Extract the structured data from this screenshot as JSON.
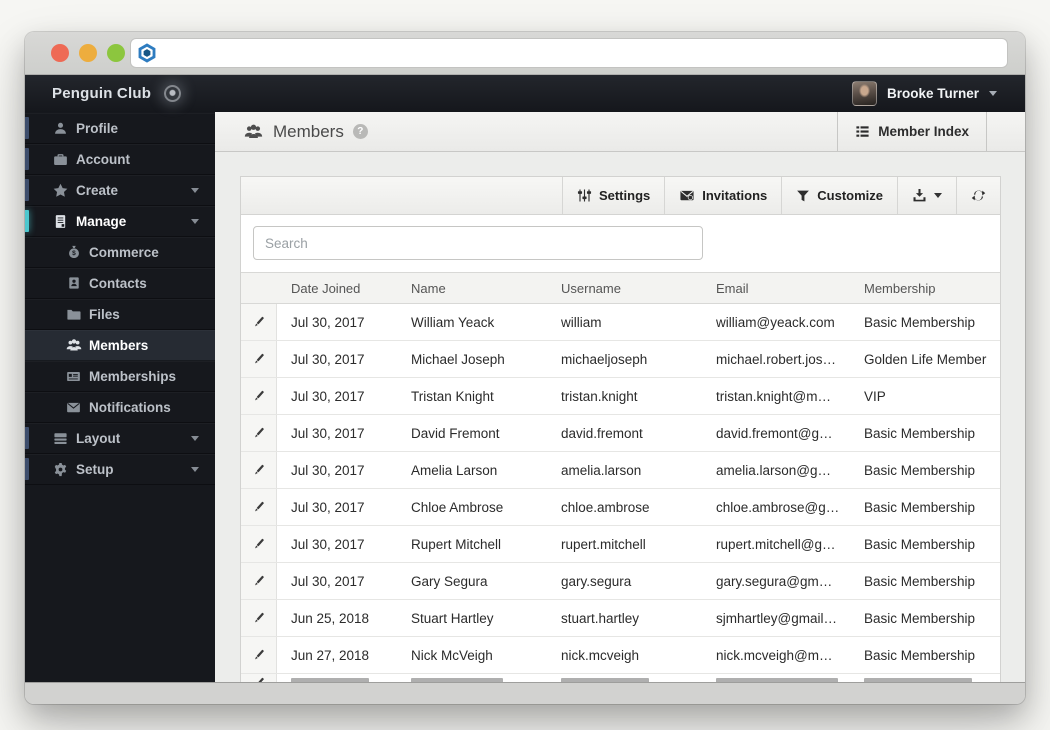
{
  "app": {
    "brand": "Penguin Club",
    "user_name": "Brooke Turner"
  },
  "sidebar": {
    "items": [
      {
        "label": "Profile",
        "icon": "person",
        "level": "top"
      },
      {
        "label": "Account",
        "icon": "briefcase",
        "level": "top"
      },
      {
        "label": "Create",
        "icon": "star",
        "level": "top",
        "caret": true
      },
      {
        "label": "Manage",
        "icon": "journal",
        "level": "top",
        "caret": true,
        "expanded": true,
        "edge_active": true
      },
      {
        "label": "Commerce",
        "icon": "money-bag",
        "level": "sub"
      },
      {
        "label": "Contacts",
        "icon": "contact-card",
        "level": "sub"
      },
      {
        "label": "Files",
        "icon": "folder",
        "level": "sub"
      },
      {
        "label": "Members",
        "icon": "people",
        "level": "sub",
        "active": true
      },
      {
        "label": "Memberships",
        "icon": "id-card",
        "level": "sub"
      },
      {
        "label": "Notifications",
        "icon": "envelope",
        "level": "sub"
      },
      {
        "label": "Layout",
        "icon": "rows",
        "level": "top",
        "caret": true
      },
      {
        "label": "Setup",
        "icon": "gear",
        "level": "top",
        "caret": true
      }
    ]
  },
  "page": {
    "title": "Members",
    "member_index": "Member Index"
  },
  "toolbar": {
    "settings": "Settings",
    "invitations": "Invitations",
    "customize": "Customize"
  },
  "search": {
    "placeholder": "Search"
  },
  "table": {
    "columns": [
      "Date Joined",
      "Name",
      "Username",
      "Email",
      "Membership"
    ],
    "rows": [
      {
        "date": "Jul 30, 2017",
        "name": "William Yeack",
        "username": "william",
        "email": "william@yeack.com",
        "membership": "Basic Membership"
      },
      {
        "date": "Jul 30, 2017",
        "name": "Michael Joseph",
        "username": "michaeljoseph",
        "email": "michael.robert.jos…",
        "membership": "Golden Life Member"
      },
      {
        "date": "Jul 30, 2017",
        "name": "Tristan Knight",
        "username": "tristan.knight",
        "email": "tristan.knight@m…",
        "membership": "VIP"
      },
      {
        "date": "Jul 30, 2017",
        "name": "David Fremont",
        "username": "david.fremont",
        "email": "david.fremont@g…",
        "membership": "Basic Membership"
      },
      {
        "date": "Jul 30, 2017",
        "name": "Amelia Larson",
        "username": "amelia.larson",
        "email": "amelia.larson@g…",
        "membership": "Basic Membership"
      },
      {
        "date": "Jul 30, 2017",
        "name": "Chloe Ambrose",
        "username": "chloe.ambrose",
        "email": "chloe.ambrose@g…",
        "membership": "Basic Membership"
      },
      {
        "date": "Jul 30, 2017",
        "name": "Rupert Mitchell",
        "username": "rupert.mitchell",
        "email": "rupert.mitchell@g…",
        "membership": "Basic Membership"
      },
      {
        "date": "Jul 30, 2017",
        "name": "Gary Segura",
        "username": "gary.segura",
        "email": "gary.segura@gm…",
        "membership": "Basic Membership"
      },
      {
        "date": "Jun 25, 2018",
        "name": "Stuart Hartley",
        "username": "stuart.hartley",
        "email": "sjmhartley@gmail…",
        "membership": "Basic Membership"
      },
      {
        "date": "Jun 27, 2018",
        "name": "Nick McVeigh",
        "username": "nick.mcveigh",
        "email": "nick.mcveigh@m…",
        "membership": "Basic Membership"
      }
    ],
    "partial_row_visible": true
  },
  "colors": {
    "sidebar_bg": "#16181d",
    "header_bg": "#17191d",
    "active_item_bg": "#262b33",
    "accent_teal": "#4cc7ce",
    "edge_tab_blue": "#3e4e6c",
    "traffic_red": "#ee6a55",
    "traffic_yellow": "#edad3e",
    "traffic_green": "#8cc63e",
    "logo_blue": "#2e7cc0"
  },
  "icons": {
    "logo": "blue-hexagon",
    "brand_orb": "glowing-dot-circle",
    "chevron_down": "caret",
    "profile": "person",
    "account": "briefcase",
    "create": "star",
    "manage": "journal",
    "commerce": "money-bag",
    "contacts": "contact-card",
    "files": "folder",
    "members": "people-group",
    "memberships": "id-card",
    "notifications": "envelope",
    "layout": "stacked-rows",
    "setup": "gear",
    "page_title": "people-group",
    "help": "question-circle",
    "member_index": "bulleted-list",
    "settings": "sliders",
    "invitations": "sealed-envelope",
    "customize": "funnel",
    "export": "download-tray",
    "refresh": "circular-arrows",
    "row_edit": "pencil"
  }
}
